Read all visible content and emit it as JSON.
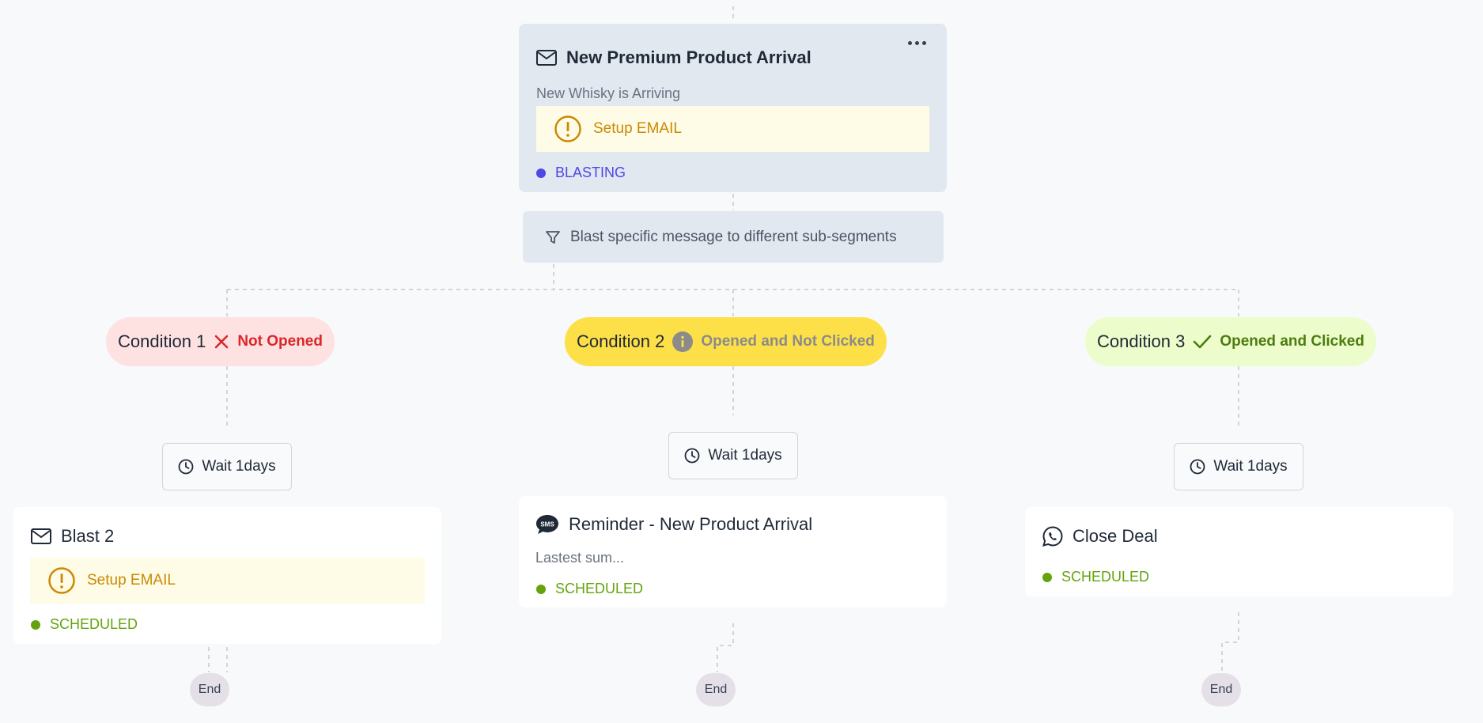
{
  "main_card": {
    "title": "New Premium Product Arrival",
    "subtitle": "New Whisky is Arriving",
    "warning": "Setup EMAIL",
    "status": "BLASTING",
    "icon": "mail-icon"
  },
  "filter": {
    "label": "Blast specific message to different sub-segments",
    "icon": "funnel-icon"
  },
  "branches": [
    {
      "condition": "Condition 1",
      "tag": "Not Opened",
      "tag_icon": "x-icon",
      "wait": "Wait 1days",
      "card": {
        "title": "Blast 2",
        "icon": "mail-icon",
        "warning": "Setup EMAIL",
        "status": "SCHEDULED"
      },
      "end": "End"
    },
    {
      "condition": "Condition 2",
      "tag": "Opened and Not Clicked",
      "tag_icon": "info-icon",
      "wait": "Wait 1days",
      "card": {
        "title": "Reminder - New Product Arrival",
        "icon": "sms-icon",
        "subtitle": "Lastest sum...",
        "status": "SCHEDULED"
      },
      "end": "End"
    },
    {
      "condition": "Condition 3",
      "tag": "Opened and Clicked",
      "tag_icon": "check-icon",
      "wait": "Wait 1days",
      "card": {
        "title": "Close Deal",
        "icon": "whatsapp-icon",
        "status": "SCHEDULED"
      },
      "end": "End"
    }
  ],
  "colors": {
    "blasting": "#4f46e5",
    "scheduled": "#65a30d",
    "warning": "#ca8a04",
    "not_opened_bg": "#fee2e2",
    "not_opened_text": "#dc2626",
    "opened_not_clicked_bg": "#fde047",
    "opened_not_clicked_text": "#8b8b8b",
    "opened_clicked_bg": "#ecfccb",
    "opened_clicked_text": "#4d7c0f"
  }
}
